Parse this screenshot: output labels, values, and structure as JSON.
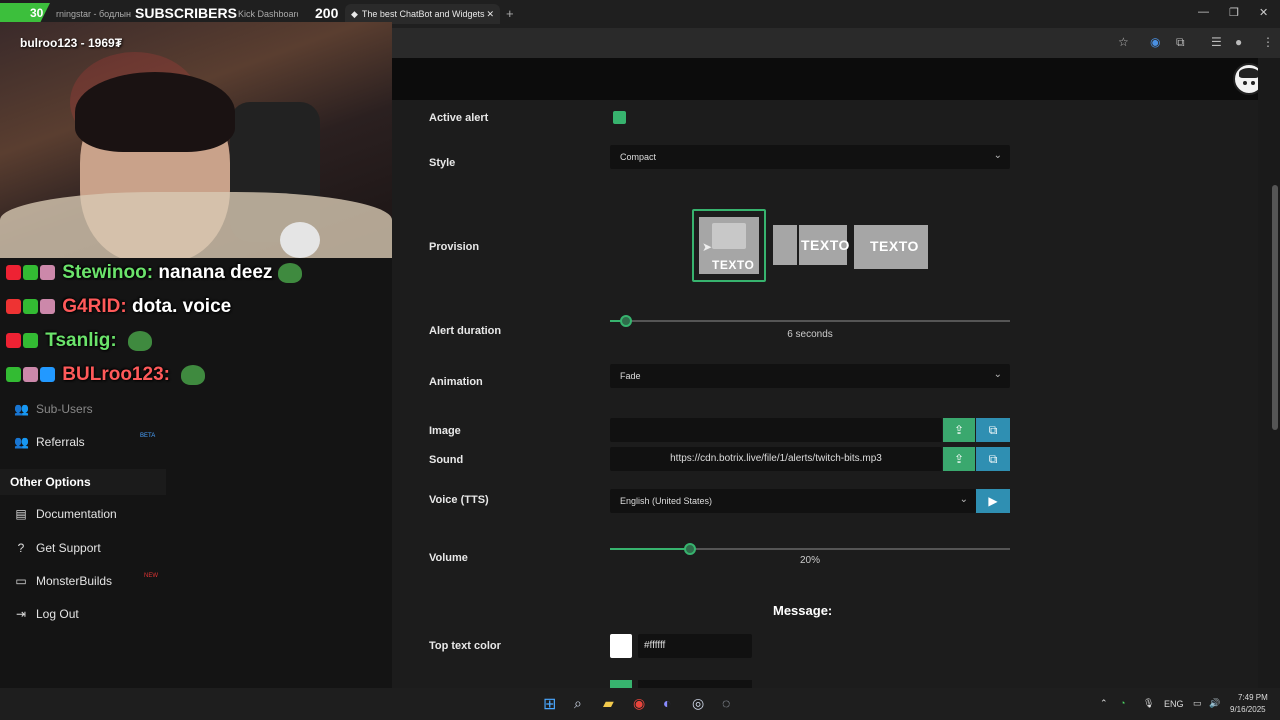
{
  "browser": {
    "tabs": [
      {
        "label": "rningstar - бодлын гу"
      },
      {
        "label": "Kick Dashboard"
      },
      {
        "label": "The best ChatBot and Widgets"
      }
    ],
    "new_tab_label": "+",
    "window_controls": {
      "minimize": "—",
      "restore": "❐",
      "close": "✕"
    }
  },
  "stream_overlay": {
    "badge_count": "30",
    "subscribers_label": "SUBSCRIBERS",
    "subscriber_count": "200",
    "top_user": "bulroo123 - 1969₮"
  },
  "chat": [
    {
      "user": "Stewinoo:",
      "message": "nanana deez"
    },
    {
      "user": "G4RID:",
      "message": "dota. voice"
    },
    {
      "user": "Tsanlig:",
      "message": ""
    },
    {
      "user": "BULroo123:",
      "message": ""
    }
  ],
  "sidebar": {
    "items_top": [
      {
        "label": "Sub-Users",
        "icon": "users-icon"
      },
      {
        "label": "Referrals",
        "icon": "referral-icon",
        "badge": "BETA"
      }
    ],
    "section_header": "Other Options",
    "items_bottom": [
      {
        "label": "Documentation",
        "icon": "book-icon"
      },
      {
        "label": "Get Support",
        "icon": "help-icon"
      },
      {
        "label": "MonsterBuilds",
        "icon": "laptop-icon",
        "badge": "NEW"
      },
      {
        "label": "Log Out",
        "icon": "logout-icon"
      }
    ]
  },
  "form": {
    "active_alert": {
      "label": "Active alert",
      "checked": true
    },
    "style": {
      "label": "Style",
      "value": "Compact"
    },
    "provision": {
      "label": "Provision",
      "option_text": "TEXTO",
      "selected_index": 0
    },
    "alert_duration": {
      "label": "Alert duration",
      "value_text": "6 seconds",
      "fraction": 0.04
    },
    "animation": {
      "label": "Animation",
      "value": "Fade"
    },
    "image": {
      "label": "Image",
      "value": ""
    },
    "sound": {
      "label": "Sound",
      "value": "https://cdn.botrix.live/file/1/alerts/twitch-bits.mp3"
    },
    "voice": {
      "label": "Voice (TTS)",
      "value": "English (United States)"
    },
    "volume": {
      "label": "Volume",
      "value_text": "20%",
      "fraction": 0.2
    },
    "message_header": "Message:",
    "top_text_color": {
      "label": "Top text color",
      "value": "#ffffff"
    }
  },
  "taskbar": {
    "lang": "ENG",
    "time": "7:49 PM",
    "date": "9/16/2025"
  },
  "colors": {
    "accent_green": "#37b36e",
    "teal": "#2f8fb2",
    "panel_bg": "#1c1c1c"
  }
}
